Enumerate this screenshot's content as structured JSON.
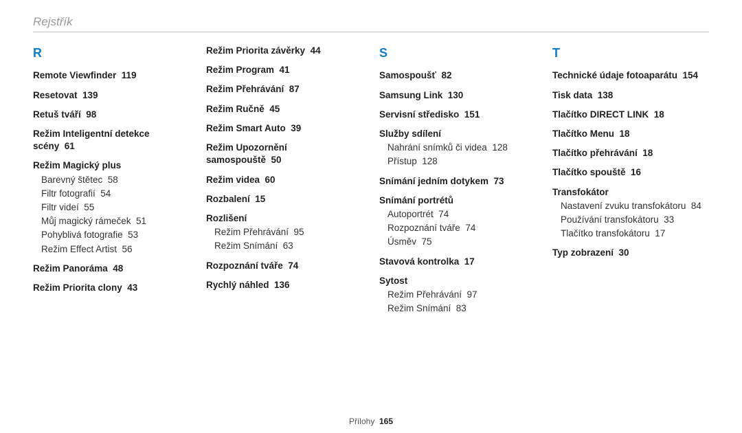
{
  "page_title": "Rejstřík",
  "footer_label": "Přílohy",
  "footer_page": "165",
  "columns": [
    {
      "letter": "R",
      "items": [
        {
          "type": "entry",
          "text": "Remote Viewfinder",
          "page": "119"
        },
        {
          "type": "entry",
          "text": "Resetovat",
          "page": "139"
        },
        {
          "type": "entry",
          "text": "Retuš tváří",
          "page": "98"
        },
        {
          "type": "entry",
          "text": "Režim Inteligentní detekce scény",
          "page": "61"
        },
        {
          "type": "entry",
          "text": "Režim Magický plus"
        },
        {
          "type": "sub",
          "text": "Barevný štětec",
          "page": "58"
        },
        {
          "type": "sub",
          "text": "Filtr fotografií",
          "page": "54"
        },
        {
          "type": "sub",
          "text": "Filtr videí",
          "page": "55"
        },
        {
          "type": "sub",
          "text": "Můj magický rámeček",
          "page": "51"
        },
        {
          "type": "sub",
          "text": "Pohyblivá fotografie",
          "page": "53"
        },
        {
          "type": "sub",
          "text": "Režim Effect Artist",
          "page": "56"
        },
        {
          "type": "entry",
          "text": "Režim Panoráma",
          "page": "48"
        },
        {
          "type": "entry",
          "text": "Režim Priorita clony",
          "page": "43"
        }
      ]
    },
    {
      "items": [
        {
          "type": "entry",
          "text": "Režim Priorita závěrky",
          "page": "44"
        },
        {
          "type": "entry",
          "text": "Režim Program",
          "page": "41"
        },
        {
          "type": "entry",
          "text": "Režim Přehrávání",
          "page": "87"
        },
        {
          "type": "entry",
          "text": "Režim Ručně",
          "page": "45"
        },
        {
          "type": "entry",
          "text": "Režim Smart Auto",
          "page": "39"
        },
        {
          "type": "entry",
          "text": "Režim Upozornění samospouště",
          "page": "50"
        },
        {
          "type": "entry",
          "text": "Režim videa",
          "page": "60"
        },
        {
          "type": "entry",
          "text": "Rozbalení",
          "page": "15"
        },
        {
          "type": "entry",
          "text": "Rozlišení"
        },
        {
          "type": "sub",
          "text": "Režim Přehrávání",
          "page": "95"
        },
        {
          "type": "sub",
          "text": "Režim Snímání",
          "page": "63"
        },
        {
          "type": "entry",
          "text": "Rozpoznání tváře",
          "page": "74"
        },
        {
          "type": "entry",
          "text": "Rychlý náhled",
          "page": "136"
        }
      ]
    },
    {
      "letter": "S",
      "items": [
        {
          "type": "entry",
          "text": "Samospoušť",
          "page": "82"
        },
        {
          "type": "entry",
          "text": "Samsung Link",
          "page": "130"
        },
        {
          "type": "entry",
          "text": "Servisní středisko",
          "page": "151"
        },
        {
          "type": "entry",
          "text": "Služby sdílení"
        },
        {
          "type": "sub",
          "text": "Nahrání snímků či videa",
          "page": "128"
        },
        {
          "type": "sub",
          "text": "Přístup",
          "page": "128"
        },
        {
          "type": "entry",
          "text": "Snímání jedním dotykem",
          "page": "73"
        },
        {
          "type": "entry",
          "text": "Snímání portrétů"
        },
        {
          "type": "sub",
          "text": "Autoportrét",
          "page": "74"
        },
        {
          "type": "sub",
          "text": "Rozpoznání tváře",
          "page": "74"
        },
        {
          "type": "sub",
          "text": "Úsměv",
          "page": "75"
        },
        {
          "type": "entry",
          "text": "Stavová kontrolka",
          "page": "17"
        },
        {
          "type": "entry",
          "text": "Sytost"
        },
        {
          "type": "sub",
          "text": "Režim Přehrávání",
          "page": "97"
        },
        {
          "type": "sub",
          "text": "Režim Snímání",
          "page": "83"
        }
      ]
    },
    {
      "letter": "T",
      "items": [
        {
          "type": "entry",
          "text": "Technické údaje fotoaparátu",
          "page": "154"
        },
        {
          "type": "entry",
          "text": "Tisk data",
          "page": "138"
        },
        {
          "type": "entry",
          "text": "Tlačítko DIRECT LINK",
          "page": "18"
        },
        {
          "type": "entry",
          "text": "Tlačítko Menu",
          "page": "18"
        },
        {
          "type": "entry",
          "text": "Tlačítko přehrávání",
          "page": "18"
        },
        {
          "type": "entry",
          "text": "Tlačítko spouště",
          "page": "16"
        },
        {
          "type": "entry",
          "text": "Transfokátor"
        },
        {
          "type": "sub",
          "text": "Nastavení zvuku transfokátoru",
          "page": "84"
        },
        {
          "type": "sub",
          "text": "Používání transfokátoru",
          "page": "33"
        },
        {
          "type": "sub",
          "text": "Tlačítko transfokátoru",
          "page": "17"
        },
        {
          "type": "entry",
          "text": "Typ zobrazení",
          "page": "30"
        }
      ]
    }
  ]
}
